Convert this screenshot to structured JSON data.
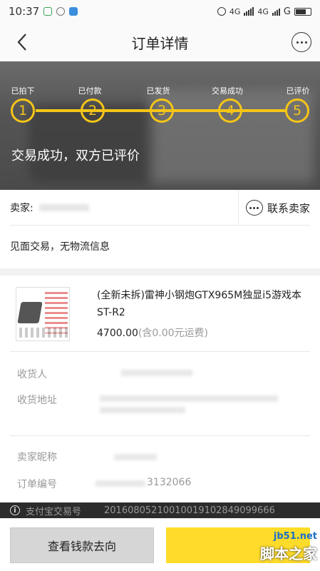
{
  "status_bar": {
    "time": "10:37",
    "network": "G",
    "network_labels": [
      "4G",
      "4G"
    ]
  },
  "nav": {
    "title": "订单详情"
  },
  "progress": {
    "steps": [
      {
        "label": "已拍下",
        "number": "1"
      },
      {
        "label": "已付款",
        "number": "2"
      },
      {
        "label": "已发货",
        "number": "3"
      },
      {
        "label": "交易成功",
        "number": "4"
      },
      {
        "label": "已评价",
        "number": "5"
      }
    ],
    "status_text": "交易成功，双方已评价",
    "accent_color": "#f5c518"
  },
  "seller": {
    "label": "卖家:",
    "contact_label": "联系卖家",
    "delivery_note": "见面交易，无物流信息"
  },
  "product": {
    "name": "(全新未拆)雷神小钢炮GTX965M独显i5游戏本ST-R2",
    "price": "4700.00",
    "shipping": "(含0.00元运费)"
  },
  "details": {
    "receiver_label": "收货人",
    "address_label": "收货地址",
    "seller_nick_label": "卖家昵称",
    "order_no_label": "订单编号",
    "order_no_partial": "3132066",
    "alipay_label": "支付宝交易号",
    "alipay_no": "20160805210010019102849099666"
  },
  "actions": {
    "money_flow_label": "查看钱款去向"
  },
  "watermark": {
    "domain": "jb51.net",
    "text": "脚本之家"
  }
}
